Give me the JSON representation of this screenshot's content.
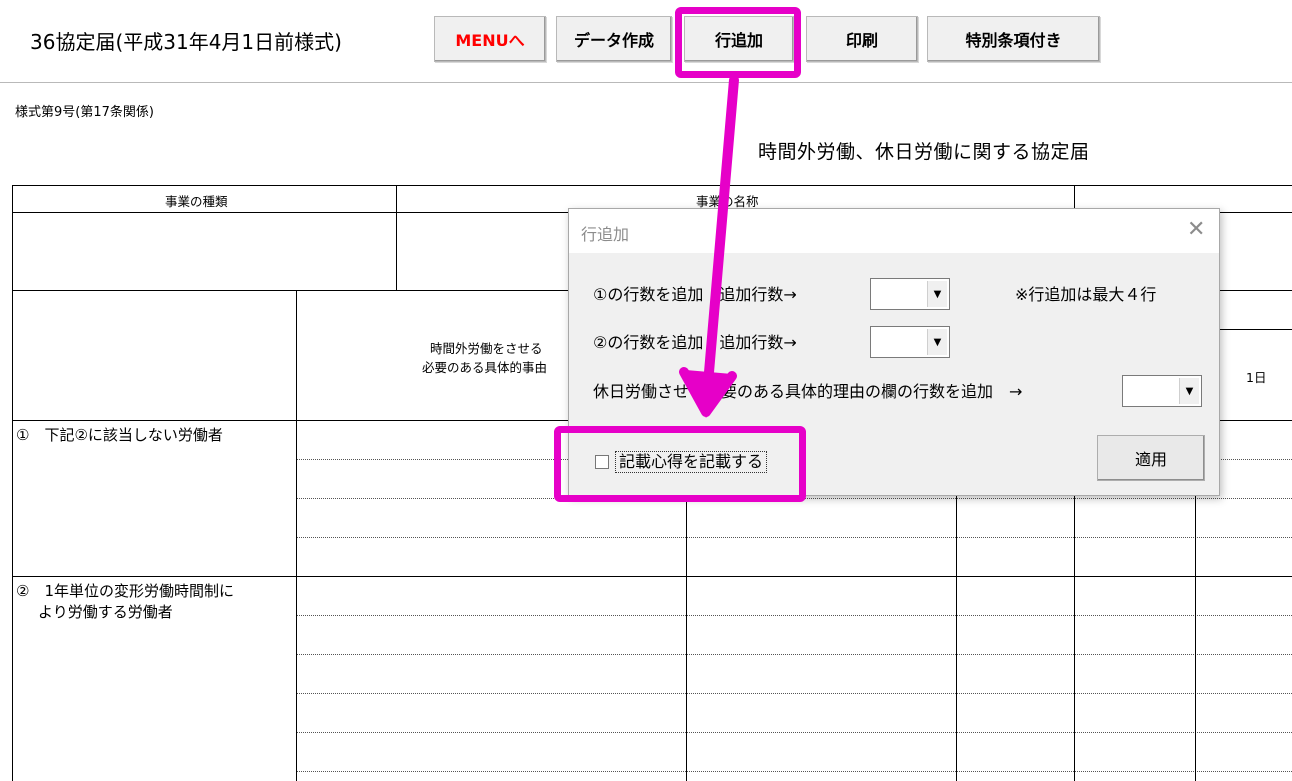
{
  "header": {
    "title": "36協定届(平成31年4月1日前様式)",
    "buttons": [
      {
        "label": "MENUへ",
        "color": "#ff0000"
      },
      {
        "label": "データ作成"
      },
      {
        "label": "行追加"
      },
      {
        "label": "印刷"
      },
      {
        "label": "特別条項付き"
      }
    ]
  },
  "form": {
    "form_number": "様式第9号(第17条関係)",
    "doc_title": "時間外労働、休日労働に関する協定届",
    "col_business_type": "事業の種類",
    "col_business_name": "事業の名称",
    "reason_header_line1": "時間外労働をさせる",
    "reason_header_line2": "必要のある具体的事由",
    "day_header": "1日",
    "row1_label": "①　下記②に該当しない労働者",
    "row2_label_line1": "②　1年単位の変形労働時間制に",
    "row2_label_line2": "より労働する労働者"
  },
  "dialog": {
    "title": "行追加",
    "row1_label": "①の行数を追加　追加行数→",
    "row2_label": "②の行数を追加　追加行数→",
    "row3_label": "休日労働させる必要のある具体的理由の欄の行数を追加　→",
    "note": "※行追加は最大４行",
    "combo1_value": "",
    "combo2_value": "",
    "combo3_value": "",
    "checkbox_label": "記載心得を記載する",
    "checkbox_checked": false,
    "apply_label": "適用"
  },
  "annotation_color": "#e600c8"
}
